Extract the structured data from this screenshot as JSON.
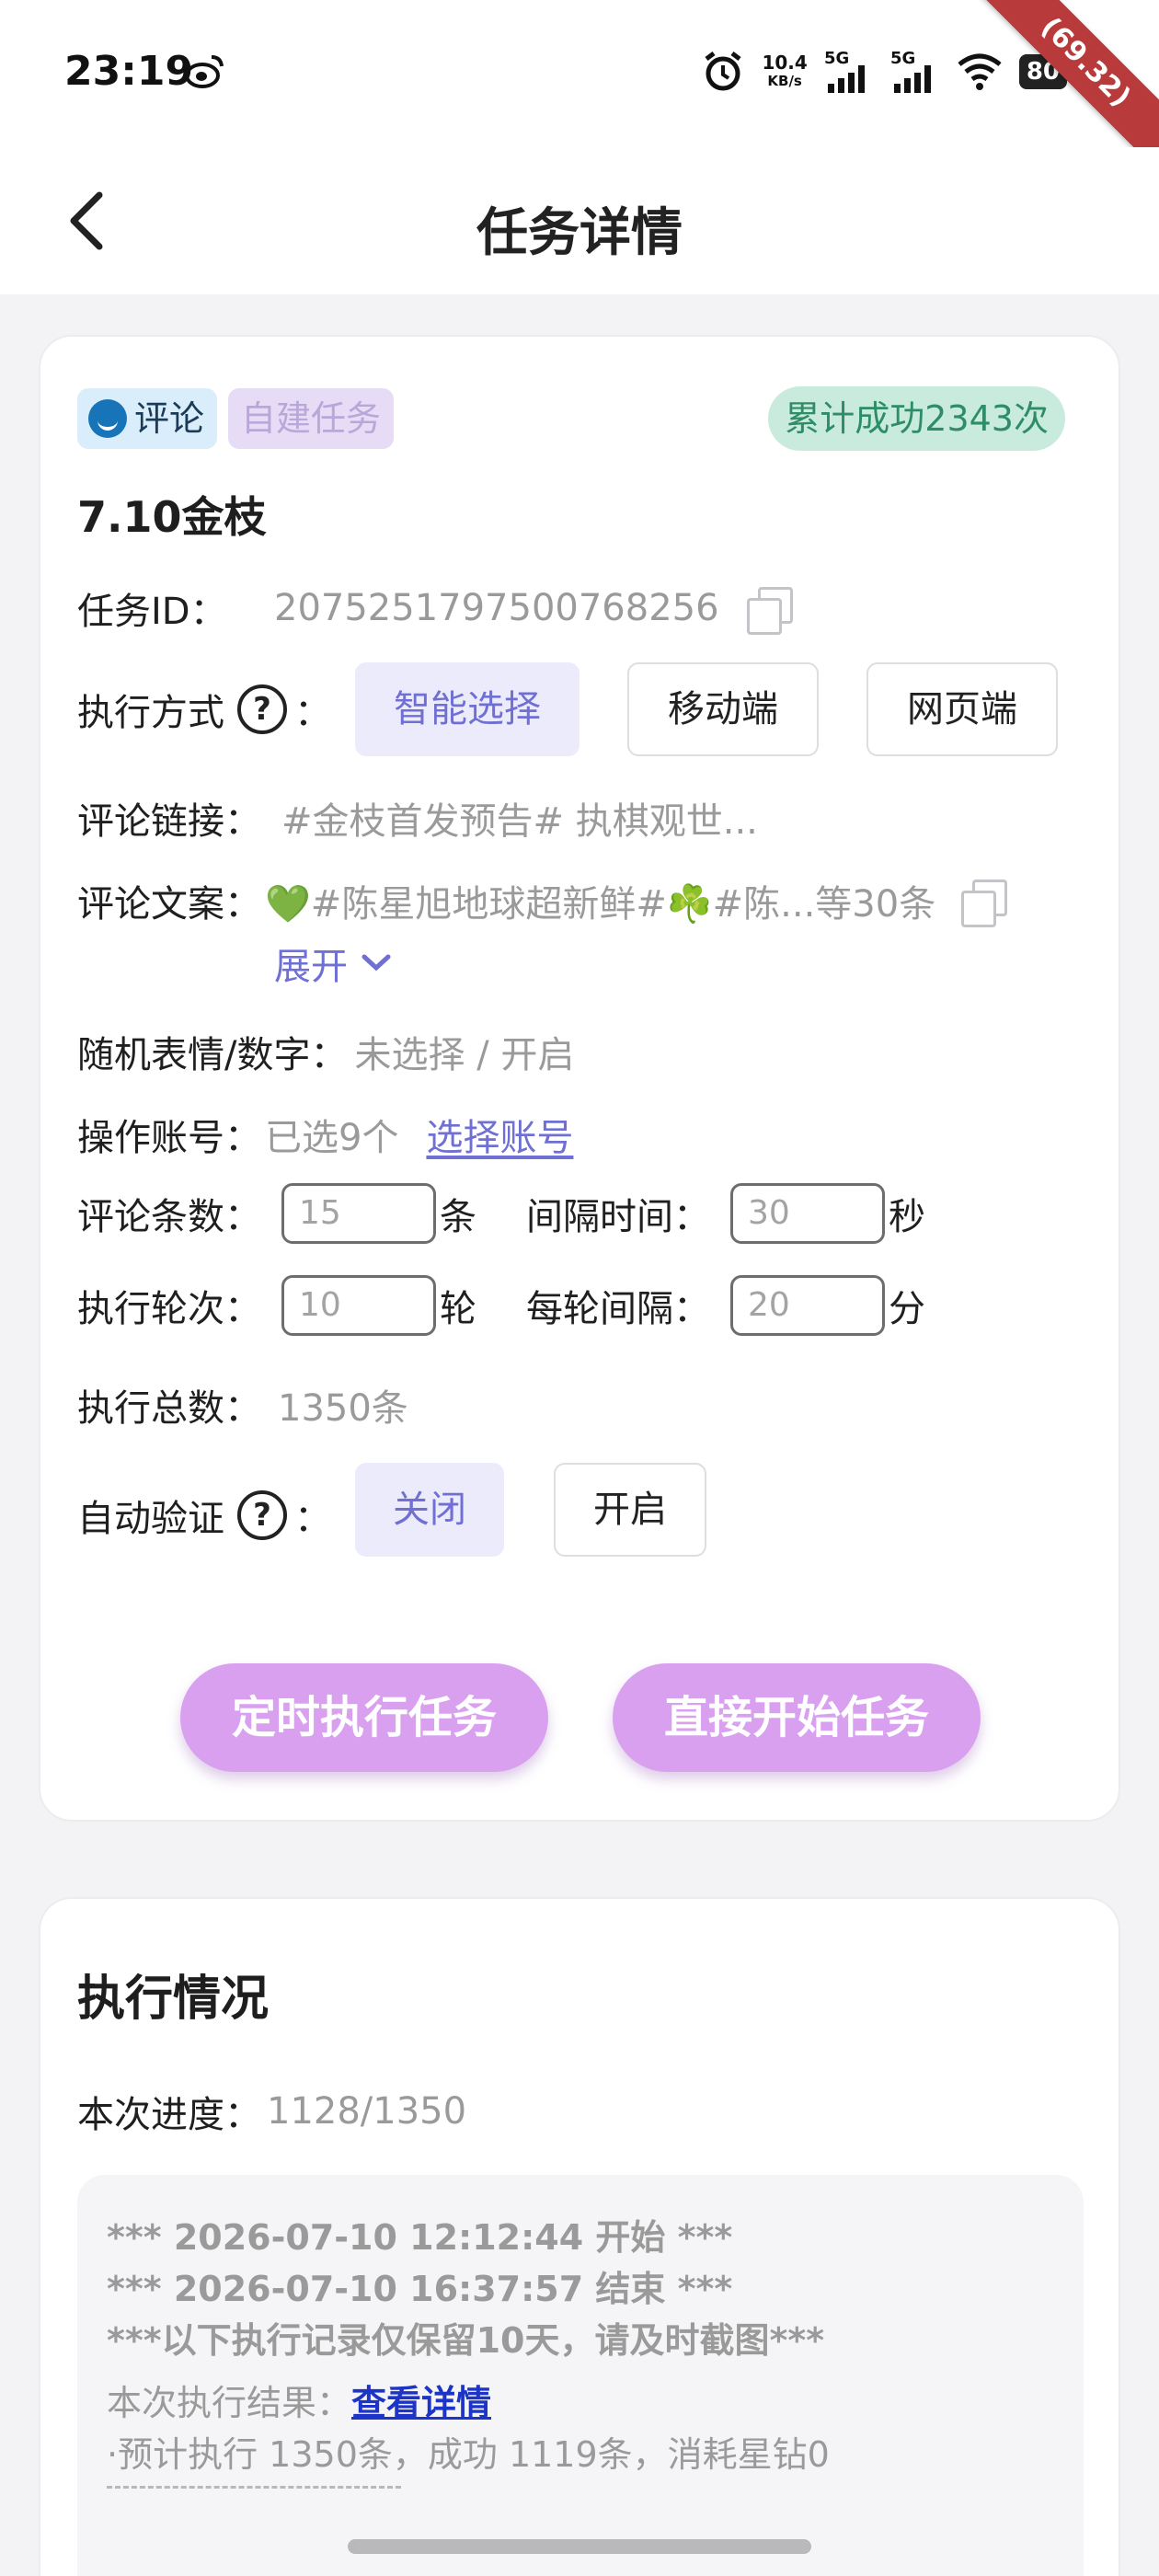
{
  "status_bar": {
    "time": "23:19",
    "net_rate": "10.4",
    "net_unit": "KB/s",
    "sig1": "5G",
    "sig2": "5G",
    "battery": "80",
    "ribbon": "(69.32)",
    "icons": [
      "weibo-icon",
      "alarm-icon",
      "signal-icon",
      "wifi-icon",
      "battery-icon"
    ]
  },
  "header": {
    "title": "任务详情"
  },
  "task": {
    "tag_comment": "评论",
    "tag_self": "自建任务",
    "success_badge": "累计成功2343次",
    "name": "7.10金枝",
    "id_label": "任务ID：",
    "id_value": "2075251797500768256",
    "exec_mode_label": "执行方式",
    "exec_mode_colon": "：",
    "exec_modes": [
      "智能选择",
      "移动端",
      "网页端"
    ],
    "exec_mode_selected": "智能选择",
    "comment_link_label": "评论链接：",
    "comment_link_value": "#金枝首发预告#  执棋观世...",
    "comment_text_label": "评论文案：",
    "comment_text_value": "💚#陈星旭地球超新鲜#☘️#陈...等30条",
    "expand_label": "展开",
    "random_label": "随机表情/数字：",
    "random_value": "未选择 / 开启",
    "accounts_label": "操作账号：",
    "accounts_value": "已选9个",
    "accounts_link": "选择账号",
    "comment_count_label": "评论条数：",
    "comment_count_value": "15",
    "comment_count_unit": "条",
    "interval_label": "间隔时间：",
    "interval_value": "30",
    "interval_unit": "秒",
    "rounds_label": "执行轮次：",
    "rounds_value": "10",
    "rounds_unit": "轮",
    "round_interval_label": "每轮间隔：",
    "round_interval_value": "20",
    "round_interval_unit": "分",
    "total_label": "执行总数：",
    "total_value": "1350条",
    "auto_verify_label": "自动验证",
    "auto_verify_colon": "：",
    "auto_verify_options": [
      "关闭",
      "开启"
    ],
    "auto_verify_selected": "关闭",
    "btn_scheduled": "定时执行任务",
    "btn_start": "直接开始任务"
  },
  "execution": {
    "title": "执行情况",
    "progress_label": "本次进度：",
    "progress_value": "1128/1350",
    "progress_done": 1128,
    "progress_total": 1350,
    "log_start": "***  2026-07-10 12:12:44 开始  ***",
    "log_end": "***  2026-07-10 16:37:57 结束  ***",
    "log_notice": "***以下执行记录仅保留10天，请及时截图***",
    "result_label": "本次执行结果：",
    "result_link": "查看详情",
    "result_summary": "·预计执行 1350条，成功 1119条，消耗星钻0"
  },
  "colors": {
    "accent_purple": "#6f6fd4",
    "action_button": "#d9a0f0",
    "success_badge_bg": "#c8ebdd",
    "success_badge_text": "#2f8c69"
  }
}
